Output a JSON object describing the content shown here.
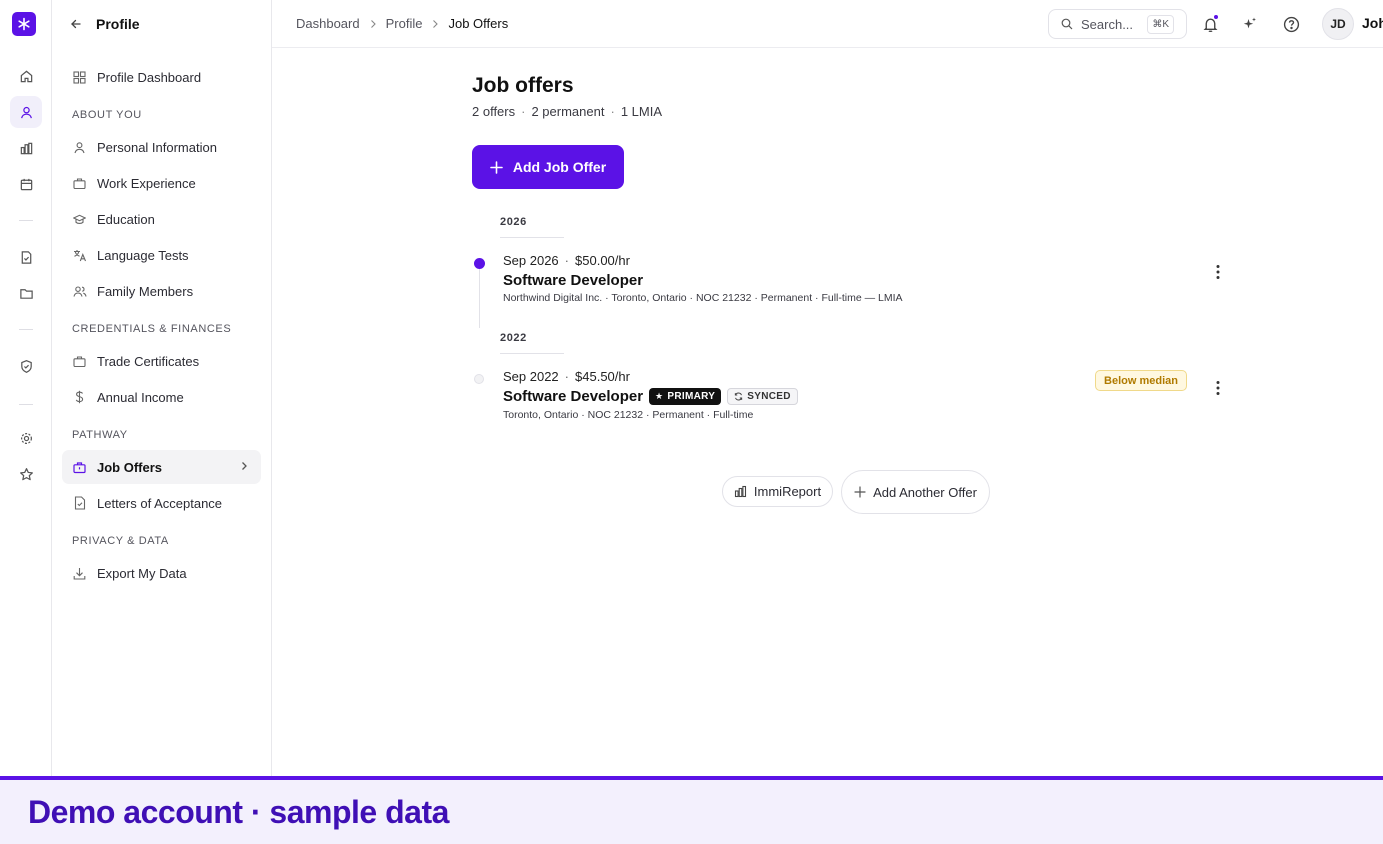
{
  "rail": {
    "icons": [
      "asterisk-logo",
      "home-icon",
      "user-icon",
      "chart-icon",
      "calendar-icon",
      "document-check-icon",
      "folder-icon",
      "shield-check-icon",
      "gear-icon",
      "star-icon"
    ]
  },
  "sidebar": {
    "title": "Profile",
    "dashboard_label": "Profile Dashboard",
    "sections": {
      "about": "ABOUT YOU",
      "credentials": "CREDENTIALS & FINANCES",
      "pathway": "PATHWAY",
      "privacy": "PRIVACY & DATA"
    },
    "items": {
      "personal": "Personal Information",
      "work": "Work Experience",
      "education": "Education",
      "language": "Language Tests",
      "family": "Family Members",
      "trade": "Trade Certificates",
      "income": "Annual Income",
      "job_offers": "Job Offers",
      "letters": "Letters of Acceptance",
      "export": "Export My Data"
    }
  },
  "topbar": {
    "breadcrumb": [
      "Dashboard",
      "Profile",
      "Job Offers"
    ],
    "search_placeholder": "Search...",
    "search_shortcut": "⌘K",
    "avatar_initials": "JD",
    "user_name": "John"
  },
  "main": {
    "title": "Job offers",
    "summary": [
      "2 offers",
      "2 permanent",
      "1 LMIA"
    ],
    "add_button": "Add Job Offer",
    "offers": [
      {
        "year": "2026",
        "date": "Sep 2026",
        "wage": "$50.00/hr",
        "title": "Software Developer",
        "details": "Northwind Digital Inc. · Toronto, Ontario · NOC 21232 · Permanent · Full-time — LMIA"
      },
      {
        "year": "2022",
        "date": "Sep 2022",
        "wage": "$45.50/hr",
        "title": "Software Developer",
        "primary_badge": "PRIMARY",
        "synced_badge": "SYNCED",
        "details": "Toronto, Ontario · NOC 21232 · Permanent · Full-time",
        "wage_flag": "Below median"
      }
    ],
    "immireport_button": "ImmiReport",
    "add_another_button": "Add Another Offer"
  },
  "banner": {
    "text": "Demo account · sample data"
  },
  "colors": {
    "accent": "#5b12e6",
    "banner_text": "#3f0fb5",
    "warning_text": "#b07a00"
  }
}
